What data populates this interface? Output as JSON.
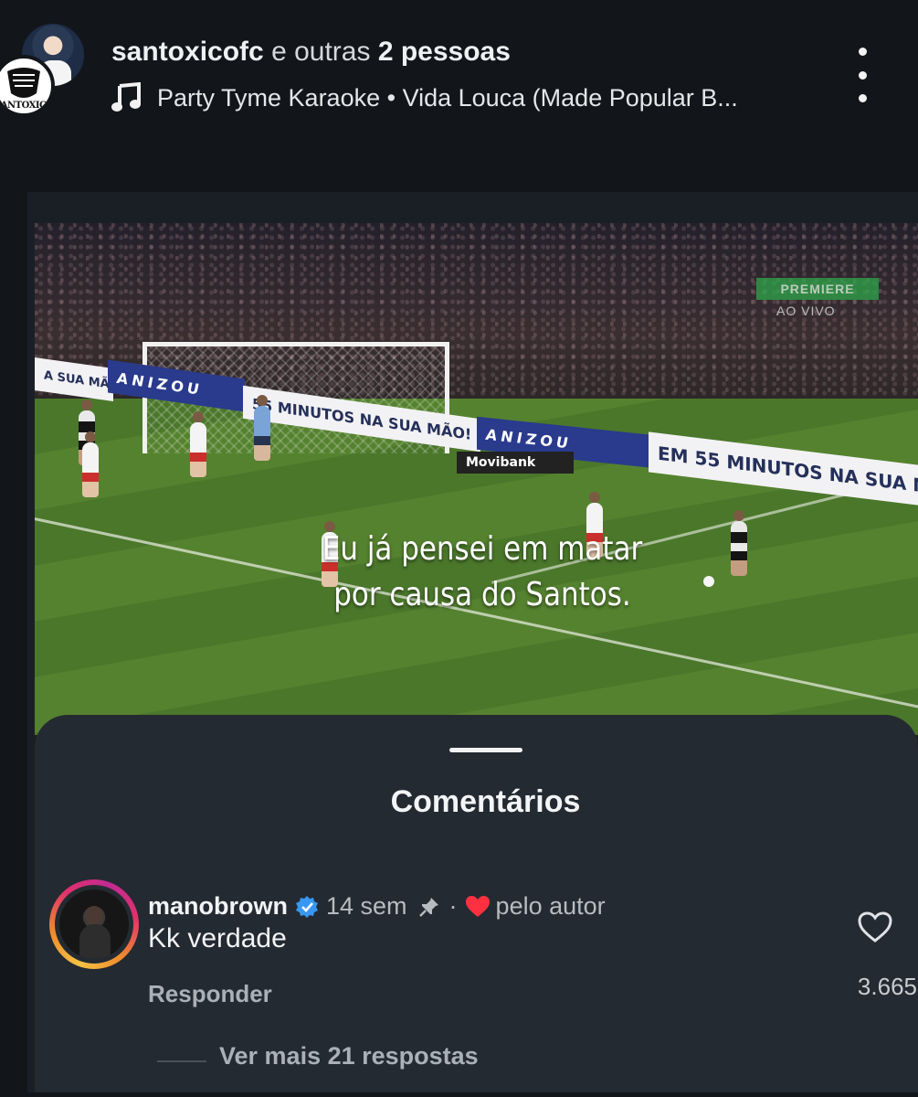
{
  "header": {
    "username": "santoxicofc",
    "others_prefix": "e outras",
    "others_count": "2 pessoas",
    "music": "Party Tyme Karaoke • Vida Louca (Made Popular B...",
    "avatar_crest_text": "SANTOXICO",
    "icons": {
      "music": "music-note-icon",
      "more": "more-vertical-icon"
    }
  },
  "video": {
    "caption_line1": "Eu já pensei em matar",
    "caption_line2": "por causa do Santos.",
    "broadcast_badge": "PREMIERE",
    "broadcast_status": "AO VIVO",
    "ads": {
      "board1": "A SUA MÃO!",
      "board2": "ANIZOU",
      "board3": "55 MINUTOS NA SUA MÃO!",
      "board4": "ANIZOU",
      "board5": "EM 55 MINUTOS NA SUA M",
      "board6": "Movibank"
    }
  },
  "comments": {
    "title": "Comentários",
    "items": [
      {
        "user": "manobrown",
        "time": "14 sem",
        "separator": "·",
        "liked_by_author": "pelo autor",
        "text": "Kk verdade",
        "reply_label": "Responder",
        "like_count": "3.665",
        "more_replies": "Ver mais 21 respostas"
      }
    ]
  },
  "colors": {
    "background": "#12161b",
    "sheet": "#242a31",
    "verified": "#3897f0",
    "heart": "#ff3040"
  }
}
